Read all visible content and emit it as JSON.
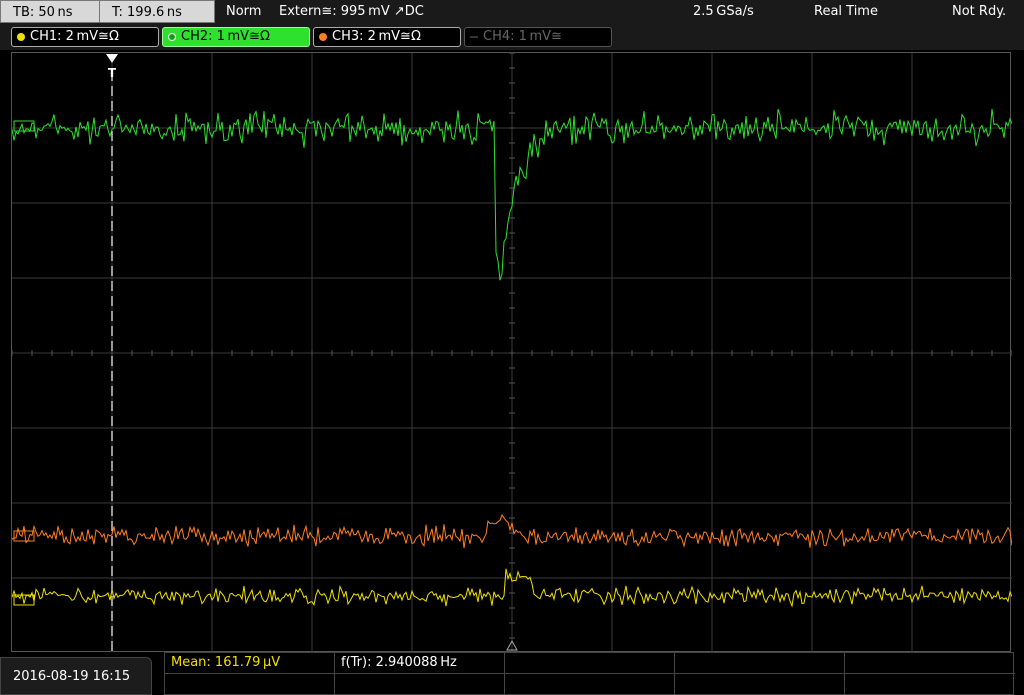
{
  "topbar": {
    "timebase": "TB: 50 ns",
    "trigger_time": "T: 199.6 ns",
    "mode": "Norm",
    "trigger_source": "Extern≅: 995 mV ↗DC",
    "sample_rate": "2.5 GSa/s",
    "acq_mode": "Real Time",
    "status": "Not Rdy."
  },
  "channels": [
    {
      "label": "CH1: 2 mV≅Ω",
      "color": "#f0e000",
      "state": "on"
    },
    {
      "label": "CH2: 1 mV≅Ω",
      "color": "#2fe02f",
      "state": "active"
    },
    {
      "label": "CH3: 2 mV≅Ω",
      "color": "#ff7f20",
      "state": "on"
    },
    {
      "label": "CH4: 1 mV≅",
      "color": "#666666",
      "state": "off"
    }
  ],
  "markers": {
    "trigger_label": "T"
  },
  "measurements": {
    "mean": "Mean: 161.79 µV",
    "freq": "f(Tr): 2.940088 Hz"
  },
  "datetime": "2016-08-19 16:15",
  "colors": {
    "ch1": "#f0e000",
    "ch2": "#2fe02f",
    "ch3": "#ff7f20",
    "meas_text": "#f0e000",
    "grid": "#3a3a3a"
  }
}
